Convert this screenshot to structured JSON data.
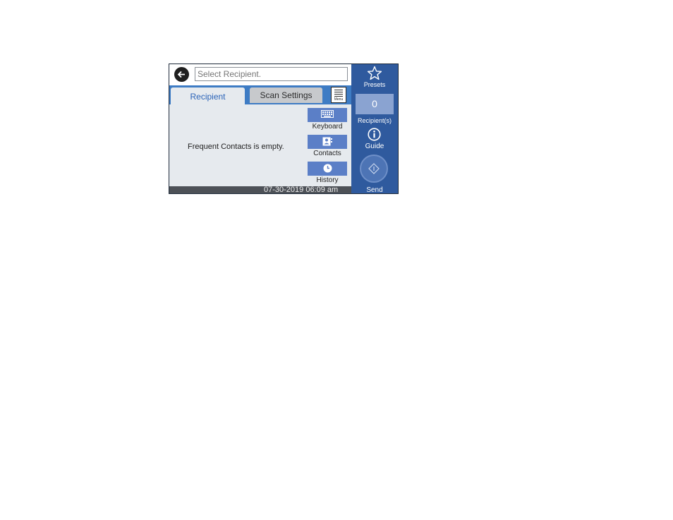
{
  "topbar": {
    "back_icon": "arrow-left-icon",
    "search_placeholder": "Select Recipient."
  },
  "tabs": [
    {
      "label": "Recipient",
      "active": true
    },
    {
      "label": "Scan Settings",
      "active": false
    }
  ],
  "menu": {
    "label": "Menu",
    "icon": "menu-lines-icon"
  },
  "main": {
    "empty_message": "Frequent Contacts is empty."
  },
  "side_buttons": [
    {
      "label": "Keyboard",
      "icon": "keyboard-icon"
    },
    {
      "label": "Contacts",
      "icon": "contacts-icon"
    },
    {
      "label": "History",
      "icon": "clock-icon"
    }
  ],
  "status": {
    "datetime": "07-30-2019 06:09 am"
  },
  "right_panel": {
    "presets_label": "Presets",
    "presets_icon": "star-icon",
    "recipient_count": "0",
    "recipient_label": "Recipient(s)",
    "guide_label": "Guide",
    "guide_icon": "info-icon",
    "send_label": "Send",
    "send_icon": "diamond-start-icon"
  },
  "colors": {
    "accent": "#3e7cc4",
    "panel": "#2f5a9e",
    "button": "#5b7fc7",
    "active_tab_text": "#2a63b8"
  }
}
